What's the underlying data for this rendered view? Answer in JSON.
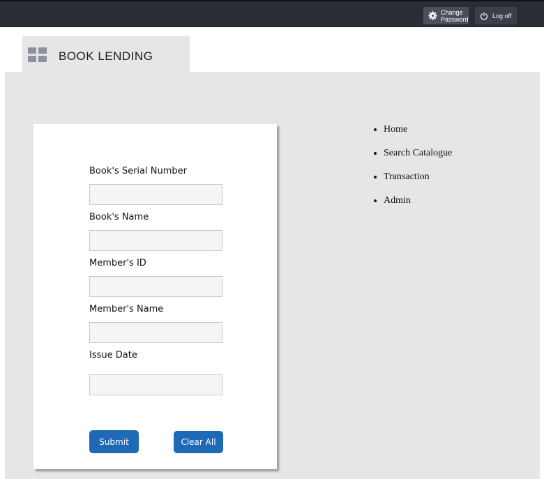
{
  "topbar": {
    "change_password_label": "Change Password",
    "change_password_line1": "Change",
    "change_password_line2": "Password",
    "logoff_label": "Log off"
  },
  "app": {
    "title": "BOOK LENDING",
    "icon": "grid-icon"
  },
  "form": {
    "fields": [
      {
        "label": "Book's Serial Number",
        "value": "",
        "placeholder": ""
      },
      {
        "label": "Book's Name",
        "value": "",
        "placeholder": ""
      },
      {
        "label": "Member's ID",
        "value": "",
        "placeholder": ""
      },
      {
        "label": "Member's Name",
        "value": "",
        "placeholder": ""
      },
      {
        "label": "Issue Date",
        "value": "",
        "placeholder": ""
      }
    ],
    "submit_label": "Submit",
    "clear_label": "Clear All"
  },
  "nav": {
    "items": [
      "Home",
      "Search Catalogue",
      "Transaction",
      "Admin"
    ]
  },
  "colors": {
    "topbar": "#2a2d34",
    "accent_button": "#1f6ab6",
    "panel_bg": "#e4e6e8"
  }
}
